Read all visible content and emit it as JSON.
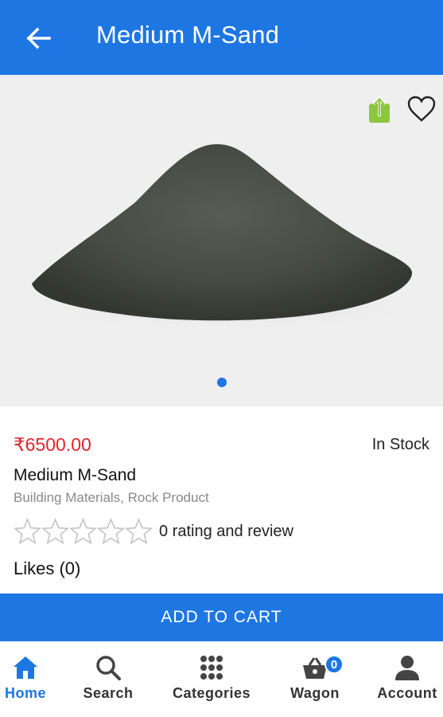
{
  "header": {
    "title": "Medium M-Sand",
    "back_icon": "arrow-left-icon"
  },
  "gallery": {
    "share_icon": "share-icon",
    "favorite_icon": "heart-outline-icon",
    "pages": 1,
    "current_page": 1
  },
  "product": {
    "price": "₹6500.00",
    "stock_status": "In Stock",
    "name": "Medium M-Sand",
    "categories": "Building Materials, Rock Product",
    "rating": 0,
    "rating_max": 5,
    "rating_text": "0 rating and review",
    "likes": "Likes (0)"
  },
  "actions": {
    "add_to_cart": "ADD TO CART"
  },
  "nav": {
    "items": [
      {
        "label": "Home",
        "icon": "home-icon",
        "active": true
      },
      {
        "label": "Search",
        "icon": "search-icon",
        "active": false
      },
      {
        "label": "Categories",
        "icon": "grid-icon",
        "active": false
      },
      {
        "label": "Wagon",
        "icon": "basket-icon",
        "active": false,
        "badge": "0"
      },
      {
        "label": "Account",
        "icon": "person-icon",
        "active": false
      }
    ]
  },
  "colors": {
    "primary": "#1e76e3",
    "price": "#e3242b",
    "share": "#8cc63f"
  }
}
